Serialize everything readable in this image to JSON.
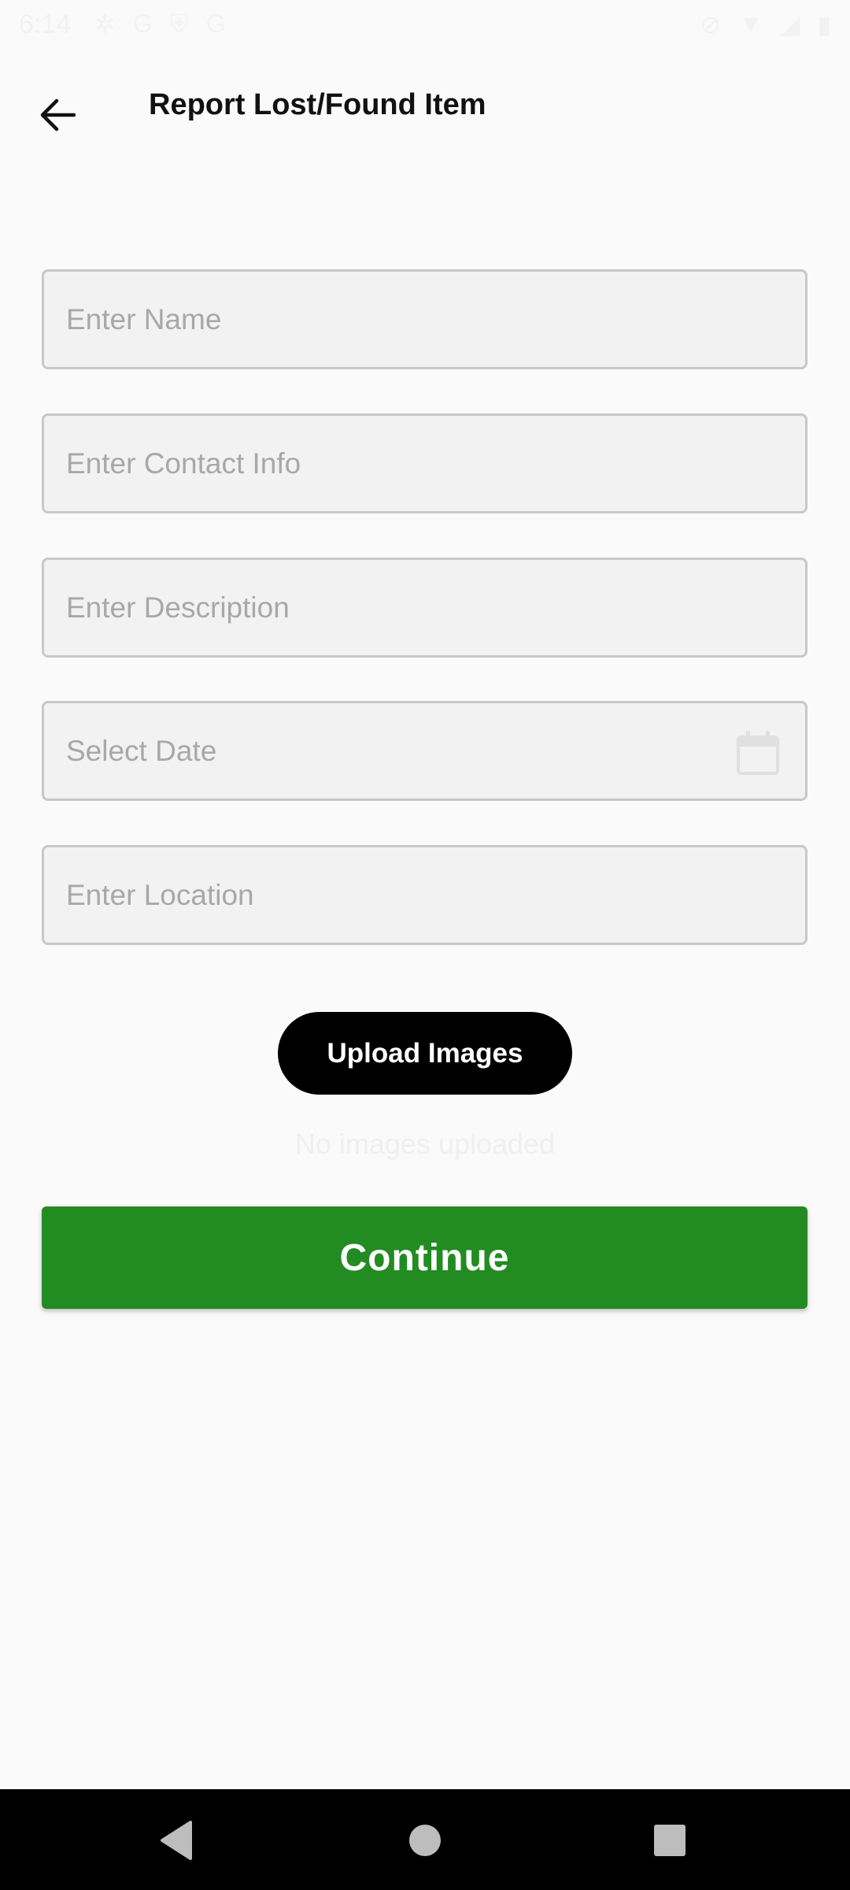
{
  "status_bar": {
    "time": "6:14",
    "left_icons": [
      "settings-icon",
      "google-icon",
      "shield-icon",
      "google-icon"
    ],
    "right_icons": [
      "mute-icon",
      "wifi-icon",
      "signal-icon",
      "battery-icon"
    ]
  },
  "header": {
    "title": "Report Lost/Found Item",
    "back_icon": "arrow-left-icon"
  },
  "form": {
    "name_placeholder": "Enter Name",
    "contact_placeholder": "Enter Contact Info",
    "description_placeholder": "Enter Description",
    "date_placeholder": "Select Date",
    "date_icon": "calendar-icon",
    "location_placeholder": "Enter Location"
  },
  "upload": {
    "label": "Upload Images",
    "empty_text": "No images uploaded"
  },
  "continue_label": "Continue",
  "colors": {
    "primary_green": "#228B22",
    "upload_black": "#000000",
    "background": "#FAFAFA"
  },
  "nav_bar": {
    "icons": [
      "back-triangle-icon",
      "home-circle-icon",
      "recents-square-icon"
    ]
  }
}
